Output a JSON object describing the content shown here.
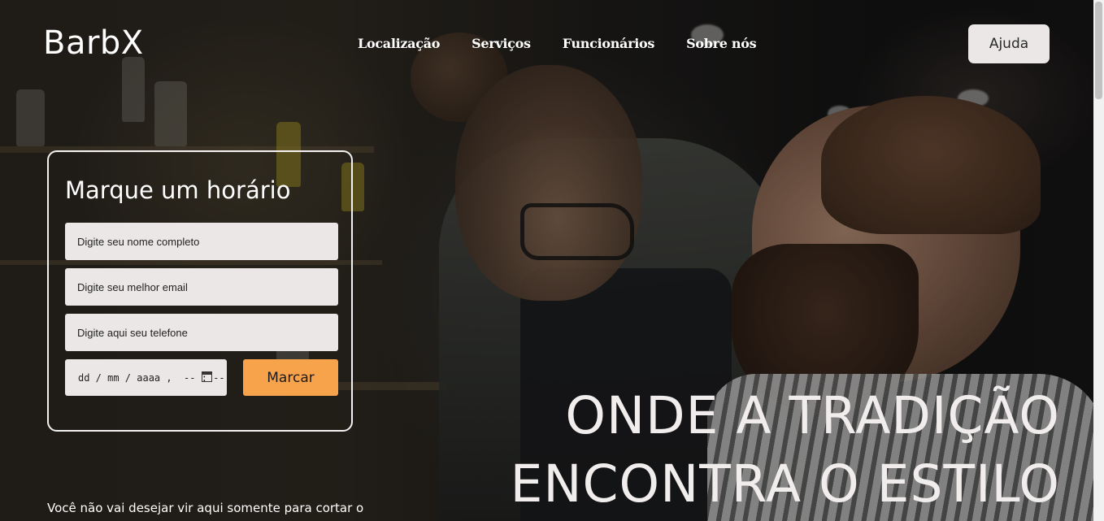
{
  "header": {
    "logo": "BarbX",
    "nav": [
      {
        "label": "Localização"
      },
      {
        "label": "Serviços"
      },
      {
        "label": "Funcionários"
      },
      {
        "label": "Sobre nós"
      }
    ],
    "help_label": "Ajuda"
  },
  "booking": {
    "title": "Marque um horário",
    "name_placeholder": "Digite seu nome completo",
    "email_placeholder": "Digite seu melhor email",
    "phone_placeholder": "Digite aqui seu telefone",
    "datetime_placeholder": "dd / mm / aaaa ,  -- : --",
    "submit_label": "Marcar"
  },
  "hero": {
    "headline_line1": "ONDE A TRADIÇÃO",
    "headline_line2": "ENCONTRA O ESTILO",
    "tagline": "Você não vai desejar vir aqui somente para cortar o"
  },
  "colors": {
    "accent": "#f7a34c",
    "field_bg": "#ebe7e6",
    "text_light": "#ffffff"
  },
  "icons": {
    "date_picker": "calendar-icon"
  }
}
